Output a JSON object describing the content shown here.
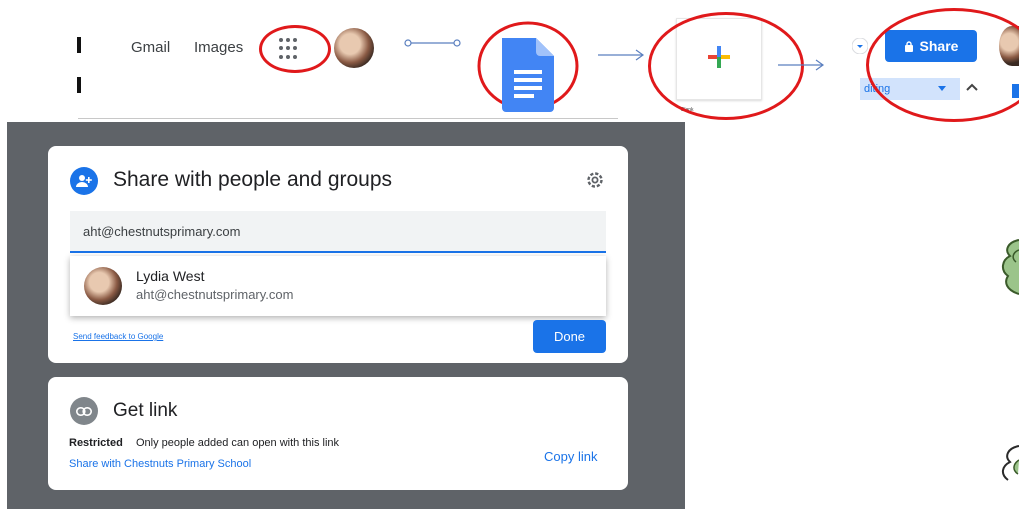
{
  "topbar": {
    "gmail_label": "Gmail",
    "images_label": "Images"
  },
  "new_doc_tile": {
    "caption": "Blank"
  },
  "share_toolbar": {
    "share_label": "Share",
    "mode_label": "diting"
  },
  "share_dialog": {
    "title": "Share with people and groups",
    "email_value": "aht@chestnutsprimary.com",
    "suggestion": {
      "name": "Lydia West",
      "email": "aht@chestnutsprimary.com"
    },
    "feedback_link": "Send feedback to Google",
    "done_label": "Done"
  },
  "link_dialog": {
    "title": "Get link",
    "restricted_label": "Restricted",
    "restricted_desc": "Only people added can open with this link",
    "share_with": "Share with Chestnuts Primary School",
    "copy_link_label": "Copy link"
  },
  "colors": {
    "accent": "#1a73e8",
    "annotation_red": "#e0191b",
    "panel_bg": "#5f6368"
  }
}
